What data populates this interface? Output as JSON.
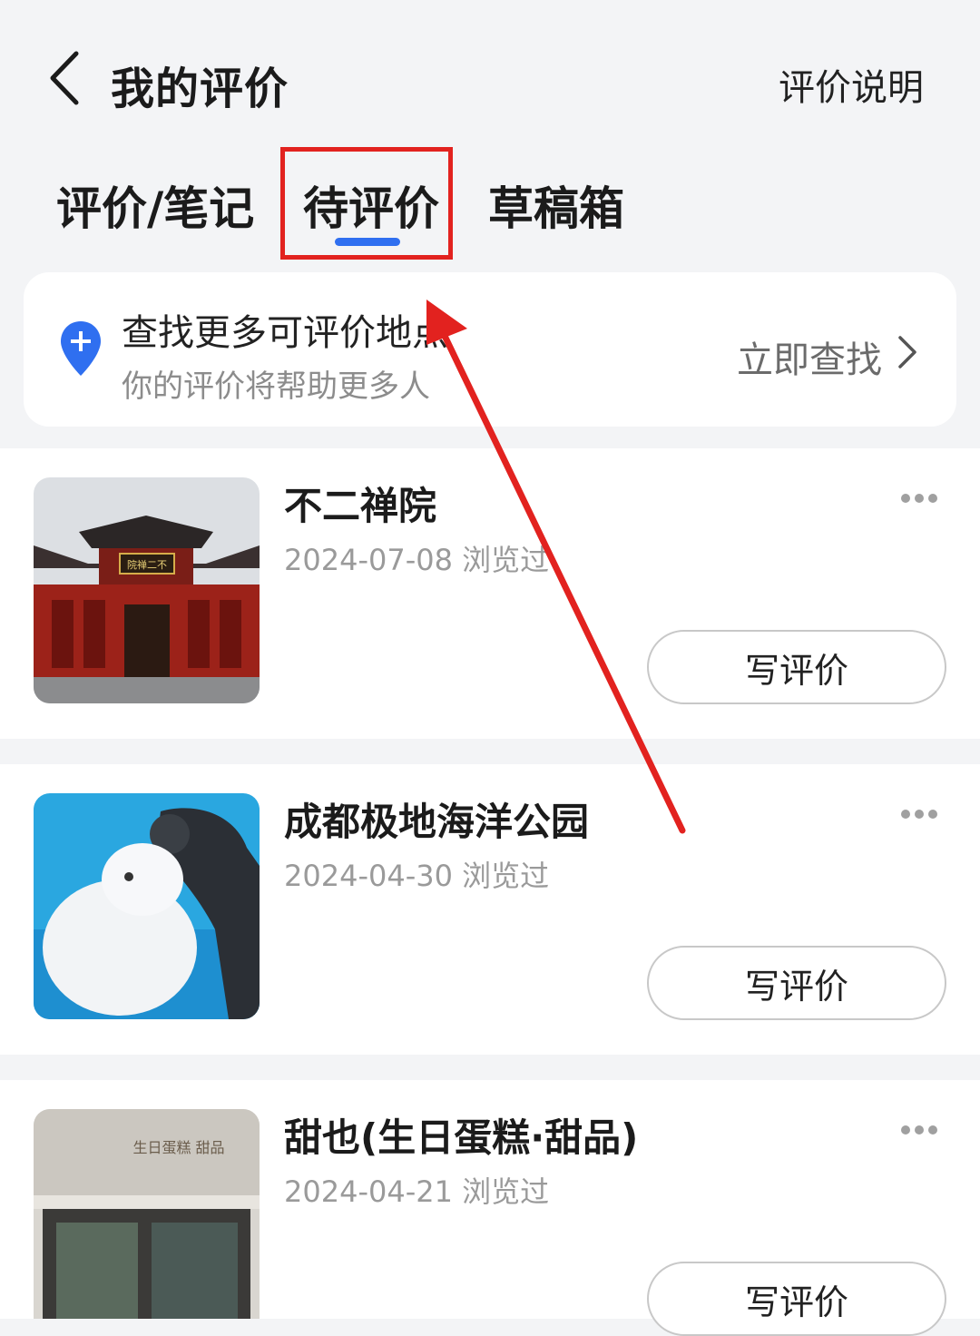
{
  "header": {
    "title": "我的评价",
    "help_link": "评价说明"
  },
  "tabs": [
    {
      "label": "评价/笔记",
      "active": false
    },
    {
      "label": "待评价",
      "active": true
    },
    {
      "label": "草稿箱",
      "active": false
    }
  ],
  "find_card": {
    "title": "查找更多可评价地点",
    "subtitle": "你的评价将帮助更多人",
    "action": "立即查找"
  },
  "items": [
    {
      "name": "不二禅院",
      "date": "2024-07-08 浏览过",
      "button": "写评价",
      "thumb_icon": "temple-photo"
    },
    {
      "name": "成都极地海洋公园",
      "date": "2024-04-30 浏览过",
      "button": "写评价",
      "thumb_icon": "beluga-photo"
    },
    {
      "name": "甜也(生日蛋糕·甜品)",
      "date": "2024-04-21 浏览过",
      "button": "写评价",
      "thumb_icon": "cake-shop-photo"
    }
  ],
  "thumb_texts": {
    "temple_plaque": "院禅二不",
    "shop_sign": "生日蛋糕 甜品"
  },
  "colors": {
    "accent": "#2f6ff0",
    "annotation": "#e2221f"
  }
}
